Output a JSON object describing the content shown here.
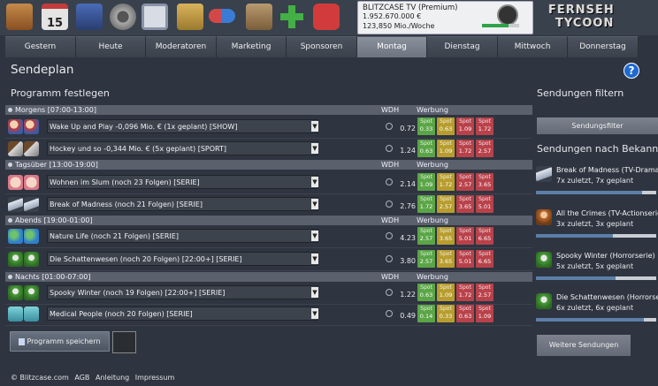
{
  "topbar": {
    "icons": [
      {
        "name": "station-icon",
        "color": "#b56a2c"
      },
      {
        "name": "calendar-icon",
        "color": "#d8d8d8"
      },
      {
        "name": "director-chair-icon",
        "color": "#3a5ba8"
      },
      {
        "name": "film-reel-icon",
        "color": "#9b9b9b"
      },
      {
        "name": "picture-frame-icon",
        "color": "#8ea0c0"
      },
      {
        "name": "money-bag-icon",
        "color": "#c9a24a"
      },
      {
        "name": "pill-icon",
        "color": "#c94a4a"
      },
      {
        "name": "building-icon",
        "color": "#a48660"
      },
      {
        "name": "plus-icon",
        "color": "#45b045"
      },
      {
        "name": "power-icon",
        "color": "#d03b3b"
      }
    ],
    "calendar_day": "15",
    "account": {
      "channel": "BLITZCASE TV (Premium)",
      "money": "1.952.670.000 €",
      "income": "123,850 Mio./Woche",
      "progress": 0.72
    },
    "logo_line1": "FERNSEH",
    "logo_line2": "TYCOON"
  },
  "tabs": [
    {
      "label": "Gestern",
      "active": false
    },
    {
      "label": "Heute",
      "active": false
    },
    {
      "label": "Moderatoren",
      "active": false
    },
    {
      "label": "Marketing",
      "active": false
    },
    {
      "label": "Sponsoren",
      "active": false
    },
    {
      "label": "Montag",
      "active": true
    },
    {
      "label": "Dienstag",
      "active": false
    },
    {
      "label": "Mittwoch",
      "active": false
    },
    {
      "label": "Donnerstag",
      "active": false
    }
  ],
  "page_title": "Sendeplan",
  "help": "?",
  "program_title": "Programm festlegen",
  "col_wdh": "WDH",
  "col_werbung": "Werbung",
  "spot_label": "Spot",
  "groups": [
    {
      "label": "Morgens [07:00-13:00]",
      "rows": [
        {
          "text": "Wake Up and Play -0,096 Mio. € (1x geplant) [SHOW]",
          "rating": "0.72",
          "icon": "band-icon",
          "spots": [
            [
              "0.33",
              "g"
            ],
            [
              "0.63",
              "y"
            ],
            [
              "1.09",
              "r"
            ],
            [
              "1.72",
              "r"
            ]
          ]
        },
        {
          "text": "Hockey und so -0,344 Mio. € (5x geplant) [SPORT]",
          "rating": "1.24",
          "icon": "hockey-icon",
          "spots": [
            [
              "0.63",
              "g"
            ],
            [
              "1.09",
              "y"
            ],
            [
              "1.72",
              "r"
            ],
            [
              "2.57",
              "r"
            ]
          ]
        }
      ]
    },
    {
      "label": "Tagsüber [13:00-19:00]",
      "rows": [
        {
          "text": "Wohnen im Slum (noch 23 Folgen) [SERIE]",
          "rating": "2.14",
          "icon": "face-icon",
          "spots": [
            [
              "1.09",
              "g"
            ],
            [
              "1.72",
              "y"
            ],
            [
              "2.57",
              "r"
            ],
            [
              "3.65",
              "r"
            ]
          ]
        },
        {
          "text": "Break of Madness (noch 21 Folgen) [SERIE]",
          "rating": "2.76",
          "icon": "plane-icon",
          "spots": [
            [
              "1.72",
              "g"
            ],
            [
              "2.57",
              "y"
            ],
            [
              "3.65",
              "r"
            ],
            [
              "5.01",
              "r"
            ]
          ]
        }
      ]
    },
    {
      "label": "Abends [19:00-01:00]",
      "rows": [
        {
          "text": "Nature Life (noch 21 Folgen) [SERIE]",
          "rating": "4.23",
          "icon": "globe-icon",
          "spots": [
            [
              "2.57",
              "g"
            ],
            [
              "3.65",
              "y"
            ],
            [
              "5.01",
              "r"
            ],
            [
              "6.65",
              "r"
            ]
          ]
        },
        {
          "text": "Die Schattenwesen (noch 20 Folgen) [22:00+] [SERIE]",
          "rating": "3.80",
          "icon": "creature-icon",
          "spots": [
            [
              "2.57",
              "g"
            ],
            [
              "3.65",
              "y"
            ],
            [
              "5.01",
              "r"
            ],
            [
              "6.65",
              "r"
            ]
          ]
        }
      ]
    },
    {
      "label": "Nachts [01:00-07:00]",
      "rows": [
        {
          "text": "Spooky Winter (noch 19 Folgen) [22:00+] [SERIE]",
          "rating": "1.22",
          "icon": "creature-icon",
          "spots": [
            [
              "0.63",
              "g"
            ],
            [
              "1.09",
              "y"
            ],
            [
              "1.72",
              "r"
            ],
            [
              "2.57",
              "r"
            ]
          ]
        },
        {
          "text": "Medical People (noch 20 Folgen) [SERIE]",
          "rating": "0.49",
          "icon": "shield-icon",
          "spots": [
            [
              "0.14",
              "g"
            ],
            [
              "0.33",
              "y"
            ],
            [
              "0.63",
              "r"
            ],
            [
              "1.09",
              "r"
            ]
          ]
        }
      ]
    }
  ],
  "save_button": "Programm speichern",
  "footer": [
    "© Blitzcase.com",
    "AGB",
    "Anleitung",
    "Impressum"
  ],
  "right": {
    "filter_title": "Sendungen filtern",
    "filter_button": "Sendungsfilter",
    "known_title": "Sendungen nach Bekanntheit",
    "items": [
      {
        "name": "Break of Madness (TV-Dramaserie)",
        "sub": "7x zuletzt, 7x geplant",
        "icon": "plane-icon",
        "progress": 0.88
      },
      {
        "name": "All the Crimes (TV-Actionserie)",
        "sub": "3x zuletzt, 3x geplant",
        "icon": "person-icon",
        "progress": 0.64
      },
      {
        "name": "Spooky Winter (Horrorserie)",
        "sub": "5x zuletzt, 5x geplant",
        "icon": "creature-icon",
        "progress": 0.66
      },
      {
        "name": "Die Schattenwesen (Horrorserie)",
        "sub": "6x zuletzt, 6x geplant",
        "icon": "creature-icon",
        "progress": 0.9
      }
    ],
    "more_button": "Weitere Sendungen"
  }
}
